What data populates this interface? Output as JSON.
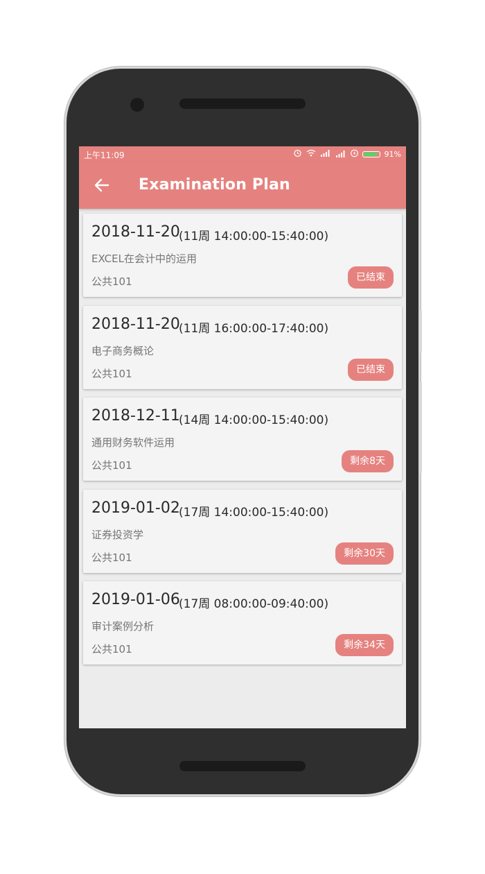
{
  "status_bar": {
    "time": "上午11:09",
    "battery_percent": "91%",
    "battery_level": 0.91,
    "icons": [
      "alarm-icon",
      "wifi-icon",
      "signal-icon",
      "hd-signal-icon",
      "charging-icon"
    ]
  },
  "app_bar": {
    "title": "Examination Plan",
    "back_icon": "arrow-left-icon"
  },
  "colors": {
    "accent": "#e5827f",
    "card_bg": "#f4f4f4",
    "screen_bg": "#ececec"
  },
  "exams": [
    {
      "date": "2018-11-20",
      "time": "(11周 14:00:00-15:40:00)",
      "course": "EXCEL在会计中的运用",
      "room": "公共101",
      "badge": "已结束"
    },
    {
      "date": "2018-11-20",
      "time": "(11周 16:00:00-17:40:00)",
      "course": "电子商务概论",
      "room": "公共101",
      "badge": "已结束"
    },
    {
      "date": "2018-12-11",
      "time": "(14周 14:00:00-15:40:00)",
      "course": "通用财务软件运用",
      "room": "公共101",
      "badge": "剩余8天"
    },
    {
      "date": "2019-01-02",
      "time": "(17周 14:00:00-15:40:00)",
      "course": "证券投资学",
      "room": "公共101",
      "badge": "剩余30天"
    },
    {
      "date": "2019-01-06",
      "time": "(17周 08:00:00-09:40:00)",
      "course": "审计案例分析",
      "room": "公共101",
      "badge": "剩余34天"
    }
  ]
}
